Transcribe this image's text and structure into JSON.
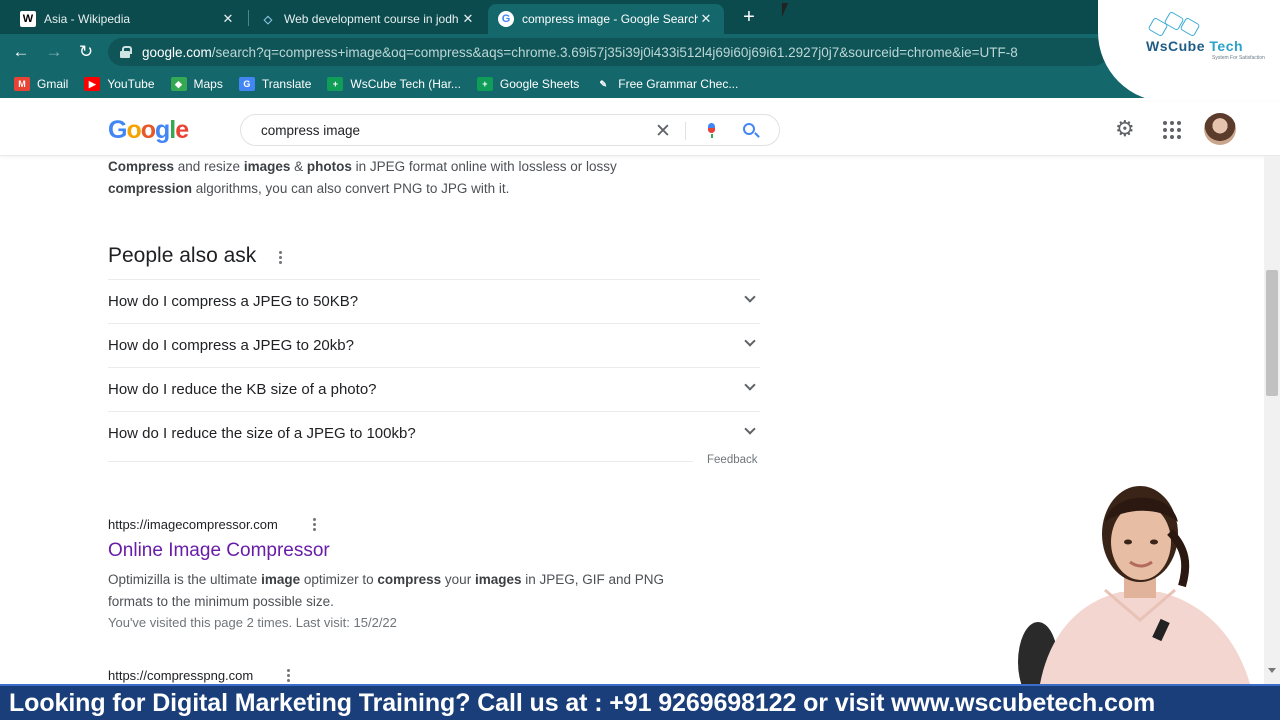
{
  "tabs": [
    {
      "favicon": "W",
      "title": "Asia - Wikipedia",
      "close": "✕"
    },
    {
      "favicon": "◇",
      "title": "Web development course in jodh",
      "close": "✕"
    },
    {
      "favicon": "G",
      "title": "compress image - Google Search",
      "close": "✕"
    }
  ],
  "new_tab": "+",
  "address": {
    "domain": "google.com",
    "path": "/search?q=compress+image&oq=compress&aqs=chrome.3.69i57j35i39j0i433i512l4j69i60j69i61.2927j0j7&sourceid=chrome&ie=UTF-8"
  },
  "bookmarks": [
    {
      "label": "Gmail",
      "icon": "gmail-icon",
      "color": "#ea4335",
      "glyph": "M"
    },
    {
      "label": "YouTube",
      "icon": "youtube-icon",
      "color": "#ff0000",
      "glyph": "▶"
    },
    {
      "label": "Maps",
      "icon": "maps-icon",
      "color": "#34a853",
      "glyph": "◆"
    },
    {
      "label": "Translate",
      "icon": "translate-icon",
      "color": "#4285f4",
      "glyph": "G"
    },
    {
      "label": "WsCube Tech (Har...",
      "icon": "sheets-icon",
      "color": "#0f9d58",
      "glyph": "+"
    },
    {
      "label": "Google Sheets",
      "icon": "sheets-icon",
      "color": "#0f9d58",
      "glyph": "+"
    },
    {
      "label": "Free Grammar Chec...",
      "icon": "feather-icon",
      "color": "#14676b",
      "glyph": "✎"
    }
  ],
  "brand": {
    "name_a": "WsCube",
    "name_b": " Tech",
    "tagline": "System For Satisfaction"
  },
  "google": {
    "logo": "Google",
    "query": "compress image",
    "clear": "✕",
    "settings": "⚙"
  },
  "results": {
    "top_snippet_line1": {
      "b1": "Compress",
      "t1": " and resize ",
      "b2": "images",
      "t2": " & ",
      "b3": "photos",
      "t3": " in JPEG format online with lossless or lossy"
    },
    "top_snippet_line2": {
      "b1": "compression",
      "t1": " algorithms, you can also convert PNG to JPG with it."
    },
    "paa_title": "People also ask",
    "paa": [
      "How do I compress a JPEG to 50KB?",
      "How do I compress a JPEG to 20kb?",
      "How do I reduce the KB size of a photo?",
      "How do I reduce the size of a JPEG to 100kb?"
    ],
    "feedback": "Feedback",
    "result1": {
      "cite": "https://imagecompressor.com",
      "title": "Online Image Compressor",
      "line1": {
        "t1": "Optimizilla is the ultimate ",
        "b1": "image",
        "t2": " optimizer to ",
        "b2": "compress",
        "t3": " your ",
        "b3": "images",
        "t4": " in JPEG, GIF and PNG"
      },
      "line2": "formats to the minimum possible size.",
      "visited": "You've visited this page 2 times. Last visit: 15/2/22"
    },
    "result2": {
      "cite": "https://compresspng.com"
    }
  },
  "banner": "Looking for Digital Marketing Training? Call us at : +91 9269698122 or visit www.wscubetech.com"
}
